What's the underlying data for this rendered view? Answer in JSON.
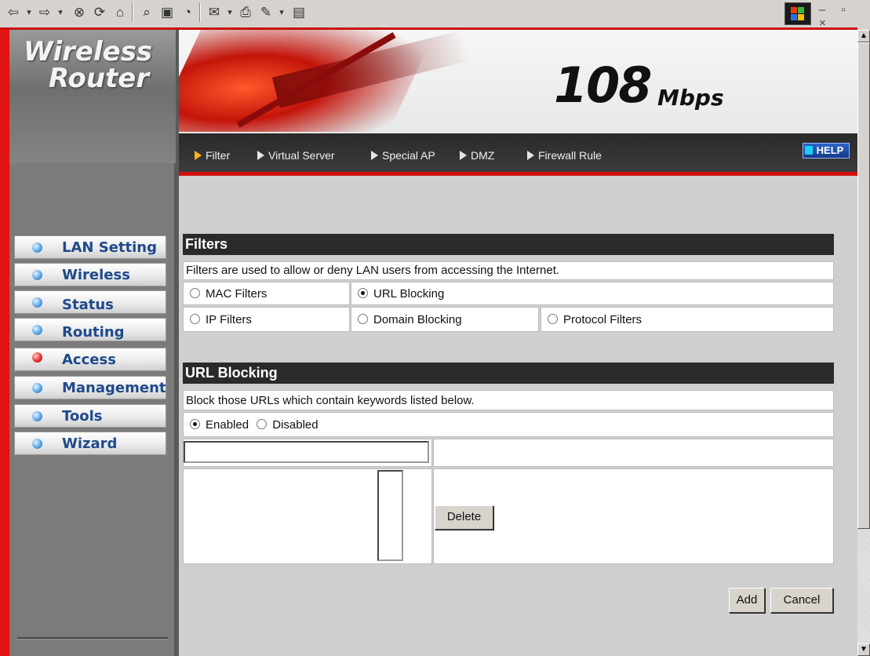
{
  "browser": {
    "toolbar_icons": [
      "back-icon",
      "forward-icon",
      "stop-icon",
      "refresh-icon",
      "home-icon",
      "search-icon",
      "favorites-icon",
      "history-icon",
      "mail-icon",
      "print-icon",
      "edit-icon",
      "discuss-icon"
    ],
    "window_controls": "– ▫ ×"
  },
  "logo": {
    "line1": "Wireless",
    "line2": "Router"
  },
  "banner": {
    "speed": "108",
    "unit": "Mbps"
  },
  "tabs": [
    {
      "label": "Filter",
      "active": true
    },
    {
      "label": "Virtual Server",
      "active": false
    },
    {
      "label": "Special AP",
      "active": false
    },
    {
      "label": "DMZ",
      "active": false
    },
    {
      "label": "Firewall Rule",
      "active": false
    }
  ],
  "help_label": "HELP",
  "sidebar": {
    "items": [
      {
        "label": "LAN Setting",
        "active": false
      },
      {
        "label": "Wireless",
        "active": false
      },
      {
        "label": "Status",
        "active": false
      },
      {
        "label": "Routing",
        "active": false
      },
      {
        "label": "Access",
        "active": true
      },
      {
        "label": "Management",
        "active": false
      },
      {
        "label": "Tools",
        "active": false
      },
      {
        "label": "Wizard",
        "active": false
      }
    ]
  },
  "filters": {
    "title": "Filters",
    "description": "Filters are used to allow or deny LAN users from accessing the Internet.",
    "options": [
      {
        "label": "MAC Filters",
        "selected": false
      },
      {
        "label": "URL Blocking",
        "selected": true
      },
      {
        "label": "IP Filters",
        "selected": false
      },
      {
        "label": "Domain Blocking",
        "selected": false
      },
      {
        "label": "Protocol Filters",
        "selected": false
      }
    ]
  },
  "url_blocking": {
    "title": "URL Blocking",
    "description": "Block those URLs which contain keywords listed below.",
    "enabled_label": "Enabled",
    "disabled_label": "Disabled",
    "enabled": true,
    "keyword_value": "",
    "delete_label": "Delete"
  },
  "actions": {
    "add_label": "Add",
    "cancel_label": "Cancel"
  },
  "colors": {
    "accent_red": "#d41010",
    "header_dark": "#2a2a2a",
    "nav_text": "#1f4a8c"
  }
}
